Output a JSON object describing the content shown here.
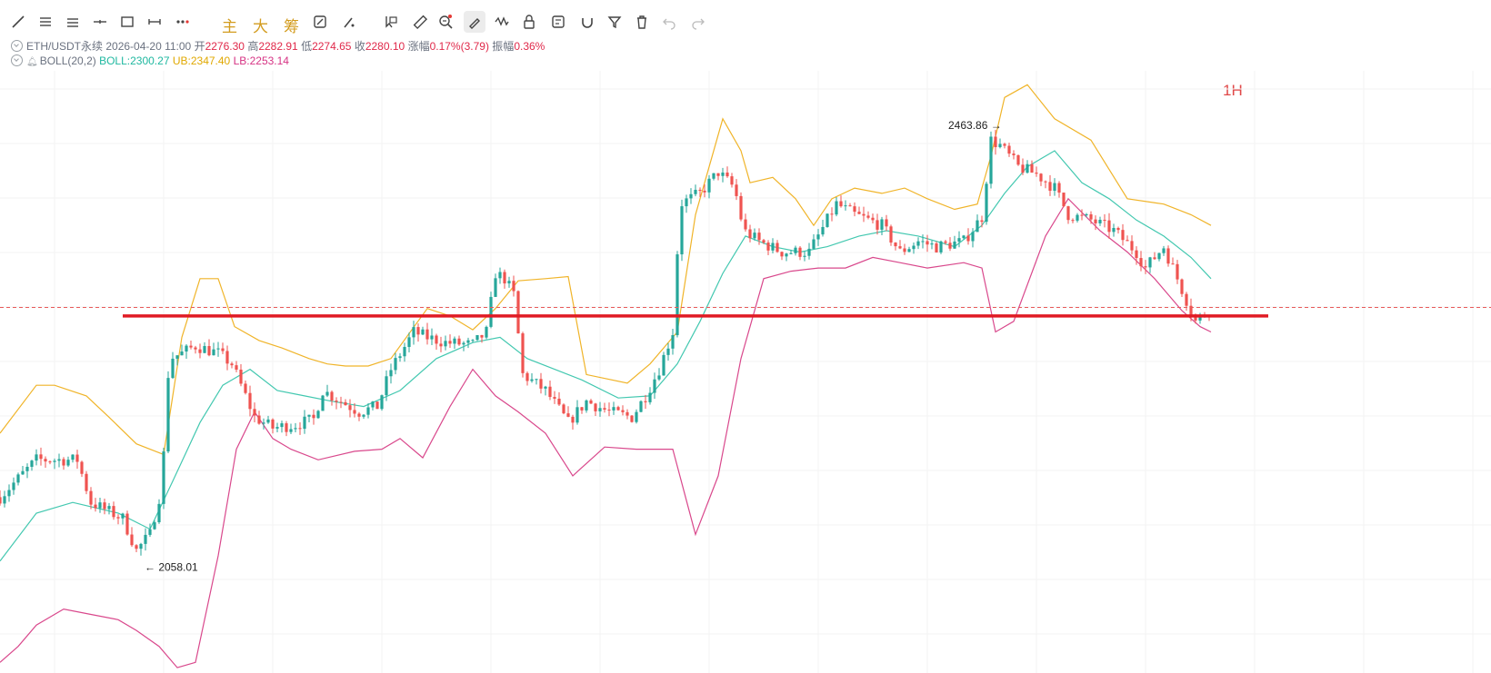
{
  "toolbar": {
    "tools": [
      "trend-line-icon",
      "horizontal-lines-icon",
      "parallel-lines-icon",
      "cross-line-icon",
      "rectangle-icon",
      "range-icon",
      "more-dots-icon",
      "chinese-main-label",
      "chinese-big-label",
      "chinese-chips-label",
      "screenshot-icon",
      "brush-icon",
      "select-cursor-icon",
      "ruler-icon",
      "zoom-icon",
      "pen-edit-icon",
      "pattern-icon",
      "lock-icon",
      "template-icon",
      "magnet-icon",
      "filter-icon",
      "delete-icon",
      "undo-icon",
      "redo-icon"
    ],
    "labels": {
      "main": "主",
      "big": "大",
      "chips": "筹"
    }
  },
  "info": {
    "symbol": "ETH/USDT永续",
    "datetime": "2026-04-20 11:00",
    "open_label": "开",
    "open": "2276.30",
    "high_label": "高",
    "high": "2282.91",
    "low_label": "低",
    "low": "2274.65",
    "close_label": "收",
    "close": "2280.10",
    "change_label": "涨幅",
    "change": "0.17%(3.79)",
    "amp_label": "振幅",
    "amp": "0.36%",
    "boll_name": "BOLL(20,2)",
    "boll": "BOLL:2300.27",
    "ub": "UB:2347.40",
    "lb": "LB:2253.14"
  },
  "timeframe": "1H",
  "colors": {
    "up": "#26a69a",
    "down": "#ef5350",
    "mid": "#43c8b0",
    "upper": "#f0b429",
    "lower": "#d9488c",
    "support": "#e01b24",
    "price_line": "#e85a5a"
  },
  "chart_data": {
    "type": "candlestick",
    "x_visible_domain": [
      0,
      1530
    ],
    "ylim": [
      1950,
      2515
    ],
    "grid": true,
    "annotations": [
      {
        "text": "2463.86",
        "x": 1095,
        "y": 2463.86
      },
      {
        "text": "2058.01",
        "x": 155,
        "y": 2058.01
      }
    ],
    "support_level": 2285,
    "last_price_line": 2293,
    "anchors": [
      [
        0,
        2115
      ],
      [
        40,
        2150
      ],
      [
        60,
        2150
      ],
      [
        85,
        2150
      ],
      [
        100,
        2110
      ],
      [
        135,
        2095
      ],
      [
        150,
        2065
      ],
      [
        165,
        2080
      ],
      [
        178,
        2125
      ],
      [
        186,
        2245
      ],
      [
        200,
        2250
      ],
      [
        215,
        2257
      ],
      [
        240,
        2250
      ],
      [
        255,
        2240
      ],
      [
        280,
        2190
      ],
      [
        300,
        2180
      ],
      [
        325,
        2183
      ],
      [
        345,
        2188
      ],
      [
        355,
        2215
      ],
      [
        375,
        2205
      ],
      [
        395,
        2195
      ],
      [
        415,
        2200
      ],
      [
        430,
        2235
      ],
      [
        455,
        2270
      ],
      [
        470,
        2265
      ],
      [
        490,
        2260
      ],
      [
        520,
        2258
      ],
      [
        535,
        2270
      ],
      [
        545,
        2325
      ],
      [
        555,
        2320
      ],
      [
        565,
        2305
      ],
      [
        575,
        2230
      ],
      [
        600,
        2215
      ],
      [
        625,
        2185
      ],
      [
        645,
        2205
      ],
      [
        670,
        2195
      ],
      [
        695,
        2190
      ],
      [
        710,
        2210
      ],
      [
        725,
        2235
      ],
      [
        740,
        2270
      ],
      [
        748,
        2390
      ],
      [
        770,
        2400
      ],
      [
        790,
        2420
      ],
      [
        808,
        2405
      ],
      [
        818,
        2365
      ],
      [
        835,
        2355
      ],
      [
        860,
        2345
      ],
      [
        890,
        2345
      ],
      [
        920,
        2390
      ],
      [
        940,
        2380
      ],
      [
        970,
        2370
      ],
      [
        990,
        2345
      ],
      [
        1010,
        2355
      ],
      [
        1030,
        2350
      ],
      [
        1060,
        2355
      ],
      [
        1080,
        2378
      ],
      [
        1090,
        2450
      ],
      [
        1100,
        2445
      ],
      [
        1120,
        2425
      ],
      [
        1140,
        2418
      ],
      [
        1160,
        2405
      ],
      [
        1175,
        2380
      ],
      [
        1200,
        2375
      ],
      [
        1225,
        2365
      ],
      [
        1250,
        2345
      ],
      [
        1260,
        2330
      ],
      [
        1280,
        2350
      ],
      [
        1300,
        2310
      ],
      [
        1315,
        2280
      ],
      [
        1325,
        2287
      ],
      [
        1332,
        2292
      ]
    ],
    "bollinger": {
      "upper": [
        [
          0,
          2175
        ],
        [
          40,
          2220
        ],
        [
          60,
          2220
        ],
        [
          95,
          2210
        ],
        [
          120,
          2190
        ],
        [
          150,
          2165
        ],
        [
          180,
          2155
        ],
        [
          200,
          2265
        ],
        [
          220,
          2320
        ],
        [
          240,
          2320
        ],
        [
          258,
          2275
        ],
        [
          285,
          2262
        ],
        [
          310,
          2255
        ],
        [
          340,
          2245
        ],
        [
          360,
          2240
        ],
        [
          380,
          2238
        ],
        [
          405,
          2238
        ],
        [
          430,
          2245
        ],
        [
          470,
          2292
        ],
        [
          495,
          2285
        ],
        [
          520,
          2272
        ],
        [
          545,
          2292
        ],
        [
          570,
          2318
        ],
        [
          600,
          2320
        ],
        [
          625,
          2322
        ],
        [
          645,
          2230
        ],
        [
          690,
          2222
        ],
        [
          715,
          2240
        ],
        [
          745,
          2270
        ],
        [
          765,
          2380
        ],
        [
          795,
          2470
        ],
        [
          815,
          2440
        ],
        [
          825,
          2410
        ],
        [
          850,
          2415
        ],
        [
          875,
          2395
        ],
        [
          895,
          2370
        ],
        [
          915,
          2395
        ],
        [
          940,
          2405
        ],
        [
          970,
          2400
        ],
        [
          995,
          2405
        ],
        [
          1020,
          2395
        ],
        [
          1050,
          2385
        ],
        [
          1075,
          2390
        ],
        [
          1090,
          2435
        ],
        [
          1105,
          2490
        ],
        [
          1130,
          2502
        ],
        [
          1160,
          2470
        ],
        [
          1200,
          2450
        ],
        [
          1240,
          2395
        ],
        [
          1280,
          2390
        ],
        [
          1310,
          2380
        ],
        [
          1332,
          2370
        ]
      ],
      "mid": [
        [
          0,
          2055
        ],
        [
          40,
          2100
        ],
        [
          80,
          2110
        ],
        [
          130,
          2100
        ],
        [
          165,
          2085
        ],
        [
          190,
          2130
        ],
        [
          220,
          2185
        ],
        [
          245,
          2220
        ],
        [
          275,
          2235
        ],
        [
          305,
          2215
        ],
        [
          335,
          2210
        ],
        [
          365,
          2205
        ],
        [
          400,
          2200
        ],
        [
          440,
          2215
        ],
        [
          480,
          2245
        ],
        [
          520,
          2260
        ],
        [
          550,
          2265
        ],
        [
          580,
          2245
        ],
        [
          610,
          2235
        ],
        [
          640,
          2225
        ],
        [
          680,
          2208
        ],
        [
          715,
          2210
        ],
        [
          745,
          2240
        ],
        [
          770,
          2280
        ],
        [
          795,
          2325
        ],
        [
          820,
          2360
        ],
        [
          850,
          2350
        ],
        [
          880,
          2345
        ],
        [
          910,
          2350
        ],
        [
          945,
          2360
        ],
        [
          975,
          2365
        ],
        [
          1010,
          2360
        ],
        [
          1050,
          2350
        ],
        [
          1080,
          2370
        ],
        [
          1105,
          2400
        ],
        [
          1130,
          2425
        ],
        [
          1160,
          2440
        ],
        [
          1190,
          2410
        ],
        [
          1220,
          2395
        ],
        [
          1250,
          2375
        ],
        [
          1280,
          2360
        ],
        [
          1310,
          2340
        ],
        [
          1332,
          2320
        ]
      ],
      "lower": [
        [
          0,
          1960
        ],
        [
          20,
          1975
        ],
        [
          40,
          1995
        ],
        [
          70,
          2010
        ],
        [
          100,
          2005
        ],
        [
          130,
          2000
        ],
        [
          150,
          1990
        ],
        [
          175,
          1975
        ],
        [
          195,
          1955
        ],
        [
          215,
          1960
        ],
        [
          240,
          2060
        ],
        [
          260,
          2160
        ],
        [
          280,
          2195
        ],
        [
          300,
          2170
        ],
        [
          320,
          2160
        ],
        [
          350,
          2150
        ],
        [
          390,
          2158
        ],
        [
          420,
          2160
        ],
        [
          440,
          2170
        ],
        [
          465,
          2152
        ],
        [
          495,
          2200
        ],
        [
          520,
          2235
        ],
        [
          545,
          2210
        ],
        [
          570,
          2195
        ],
        [
          600,
          2175
        ],
        [
          630,
          2135
        ],
        [
          665,
          2162
        ],
        [
          700,
          2160
        ],
        [
          740,
          2160
        ],
        [
          765,
          2080
        ],
        [
          790,
          2135
        ],
        [
          815,
          2245
        ],
        [
          840,
          2320
        ],
        [
          870,
          2327
        ],
        [
          900,
          2330
        ],
        [
          930,
          2330
        ],
        [
          960,
          2340
        ],
        [
          990,
          2335
        ],
        [
          1020,
          2330
        ],
        [
          1060,
          2335
        ],
        [
          1080,
          2330
        ],
        [
          1095,
          2270
        ],
        [
          1115,
          2280
        ],
        [
          1150,
          2360
        ],
        [
          1175,
          2395
        ],
        [
          1210,
          2365
        ],
        [
          1240,
          2345
        ],
        [
          1270,
          2320
        ],
        [
          1300,
          2290
        ],
        [
          1320,
          2275
        ],
        [
          1332,
          2270
        ]
      ]
    }
  }
}
